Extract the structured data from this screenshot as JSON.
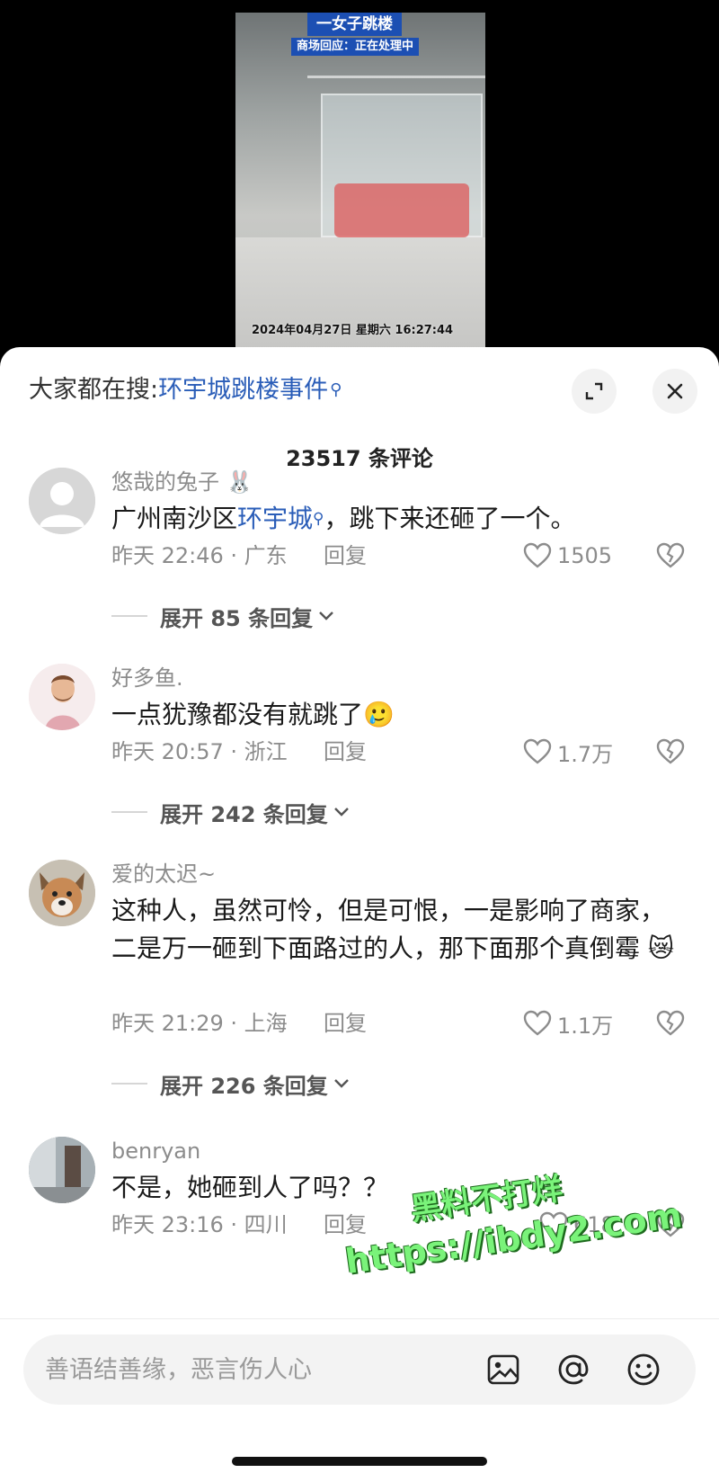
{
  "video": {
    "title_overlay": "一女子跳楼",
    "subtitle_overlay": "商场回应：正在处理中",
    "timestamp_overlay": "2024年04月27日 星期六 16:27:44"
  },
  "sheet": {
    "search_prefix": "大家都在搜:",
    "search_term": "环宇城跳楼事件",
    "comment_count": "23517 条评论"
  },
  "comments": [
    {
      "user": "悠哉的兔子 🐰",
      "text_before": "广州南沙区",
      "text_link": "环宇城",
      "text_after": "，跳下来还砸了一个。",
      "meta": "昨天 22:46 · 广东",
      "reply": "回复",
      "likes": "1505",
      "expand": "展开 85 条回复"
    },
    {
      "user": "好多鱼.",
      "text": "一点犹豫都没有就跳了🥲",
      "meta": "昨天 20:57 · 浙江",
      "reply": "回复",
      "likes": "1.7万",
      "expand": "展开 242 条回复"
    },
    {
      "user": "爱的太迟~",
      "text": "这种人，虽然可怜，但是可恨，一是影响了商家，二是万一砸到下面路过的人，那下面那个真倒霉 😿",
      "meta": "昨天 21:29 · 上海",
      "reply": "回复",
      "likes": "1.1万",
      "expand": "展开 226 条回复"
    },
    {
      "user": "benryan",
      "text": "不是，她砸到人了吗？？",
      "meta": "昨天 23:16 · 四川",
      "reply": "回复",
      "likes": "618"
    }
  ],
  "watermark": {
    "line1": "黑料不打烊",
    "line2": "https://ibdy2.com"
  },
  "input": {
    "placeholder": "善语结善缘，恶言伤人心"
  }
}
